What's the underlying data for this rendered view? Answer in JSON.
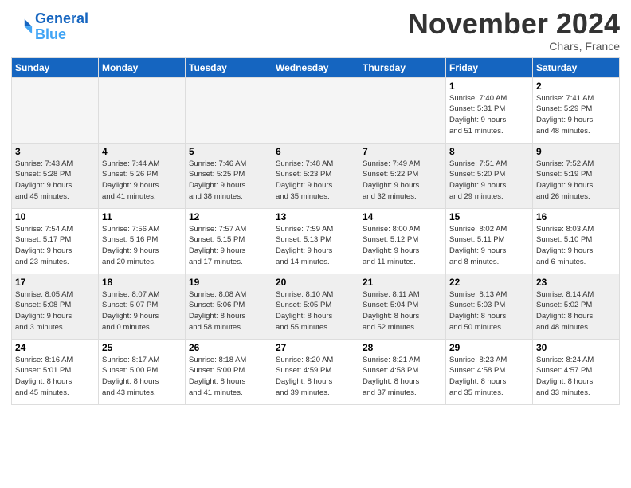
{
  "logo": {
    "line1": "General",
    "line2": "Blue"
  },
  "title": "November 2024",
  "location": "Chars, France",
  "headers": [
    "Sunday",
    "Monday",
    "Tuesday",
    "Wednesday",
    "Thursday",
    "Friday",
    "Saturday"
  ],
  "weeks": [
    [
      {
        "day": "",
        "info": ""
      },
      {
        "day": "",
        "info": ""
      },
      {
        "day": "",
        "info": ""
      },
      {
        "day": "",
        "info": ""
      },
      {
        "day": "",
        "info": ""
      },
      {
        "day": "1",
        "info": "Sunrise: 7:40 AM\nSunset: 5:31 PM\nDaylight: 9 hours\nand 51 minutes."
      },
      {
        "day": "2",
        "info": "Sunrise: 7:41 AM\nSunset: 5:29 PM\nDaylight: 9 hours\nand 48 minutes."
      }
    ],
    [
      {
        "day": "3",
        "info": "Sunrise: 7:43 AM\nSunset: 5:28 PM\nDaylight: 9 hours\nand 45 minutes."
      },
      {
        "day": "4",
        "info": "Sunrise: 7:44 AM\nSunset: 5:26 PM\nDaylight: 9 hours\nand 41 minutes."
      },
      {
        "day": "5",
        "info": "Sunrise: 7:46 AM\nSunset: 5:25 PM\nDaylight: 9 hours\nand 38 minutes."
      },
      {
        "day": "6",
        "info": "Sunrise: 7:48 AM\nSunset: 5:23 PM\nDaylight: 9 hours\nand 35 minutes."
      },
      {
        "day": "7",
        "info": "Sunrise: 7:49 AM\nSunset: 5:22 PM\nDaylight: 9 hours\nand 32 minutes."
      },
      {
        "day": "8",
        "info": "Sunrise: 7:51 AM\nSunset: 5:20 PM\nDaylight: 9 hours\nand 29 minutes."
      },
      {
        "day": "9",
        "info": "Sunrise: 7:52 AM\nSunset: 5:19 PM\nDaylight: 9 hours\nand 26 minutes."
      }
    ],
    [
      {
        "day": "10",
        "info": "Sunrise: 7:54 AM\nSunset: 5:17 PM\nDaylight: 9 hours\nand 23 minutes."
      },
      {
        "day": "11",
        "info": "Sunrise: 7:56 AM\nSunset: 5:16 PM\nDaylight: 9 hours\nand 20 minutes."
      },
      {
        "day": "12",
        "info": "Sunrise: 7:57 AM\nSunset: 5:15 PM\nDaylight: 9 hours\nand 17 minutes."
      },
      {
        "day": "13",
        "info": "Sunrise: 7:59 AM\nSunset: 5:13 PM\nDaylight: 9 hours\nand 14 minutes."
      },
      {
        "day": "14",
        "info": "Sunrise: 8:00 AM\nSunset: 5:12 PM\nDaylight: 9 hours\nand 11 minutes."
      },
      {
        "day": "15",
        "info": "Sunrise: 8:02 AM\nSunset: 5:11 PM\nDaylight: 9 hours\nand 8 minutes."
      },
      {
        "day": "16",
        "info": "Sunrise: 8:03 AM\nSunset: 5:10 PM\nDaylight: 9 hours\nand 6 minutes."
      }
    ],
    [
      {
        "day": "17",
        "info": "Sunrise: 8:05 AM\nSunset: 5:08 PM\nDaylight: 9 hours\nand 3 minutes."
      },
      {
        "day": "18",
        "info": "Sunrise: 8:07 AM\nSunset: 5:07 PM\nDaylight: 9 hours\nand 0 minutes."
      },
      {
        "day": "19",
        "info": "Sunrise: 8:08 AM\nSunset: 5:06 PM\nDaylight: 8 hours\nand 58 minutes."
      },
      {
        "day": "20",
        "info": "Sunrise: 8:10 AM\nSunset: 5:05 PM\nDaylight: 8 hours\nand 55 minutes."
      },
      {
        "day": "21",
        "info": "Sunrise: 8:11 AM\nSunset: 5:04 PM\nDaylight: 8 hours\nand 52 minutes."
      },
      {
        "day": "22",
        "info": "Sunrise: 8:13 AM\nSunset: 5:03 PM\nDaylight: 8 hours\nand 50 minutes."
      },
      {
        "day": "23",
        "info": "Sunrise: 8:14 AM\nSunset: 5:02 PM\nDaylight: 8 hours\nand 48 minutes."
      }
    ],
    [
      {
        "day": "24",
        "info": "Sunrise: 8:16 AM\nSunset: 5:01 PM\nDaylight: 8 hours\nand 45 minutes."
      },
      {
        "day": "25",
        "info": "Sunrise: 8:17 AM\nSunset: 5:00 PM\nDaylight: 8 hours\nand 43 minutes."
      },
      {
        "day": "26",
        "info": "Sunrise: 8:18 AM\nSunset: 5:00 PM\nDaylight: 8 hours\nand 41 minutes."
      },
      {
        "day": "27",
        "info": "Sunrise: 8:20 AM\nSunset: 4:59 PM\nDaylight: 8 hours\nand 39 minutes."
      },
      {
        "day": "28",
        "info": "Sunrise: 8:21 AM\nSunset: 4:58 PM\nDaylight: 8 hours\nand 37 minutes."
      },
      {
        "day": "29",
        "info": "Sunrise: 8:23 AM\nSunset: 4:58 PM\nDaylight: 8 hours\nand 35 minutes."
      },
      {
        "day": "30",
        "info": "Sunrise: 8:24 AM\nSunset: 4:57 PM\nDaylight: 8 hours\nand 33 minutes."
      }
    ]
  ]
}
